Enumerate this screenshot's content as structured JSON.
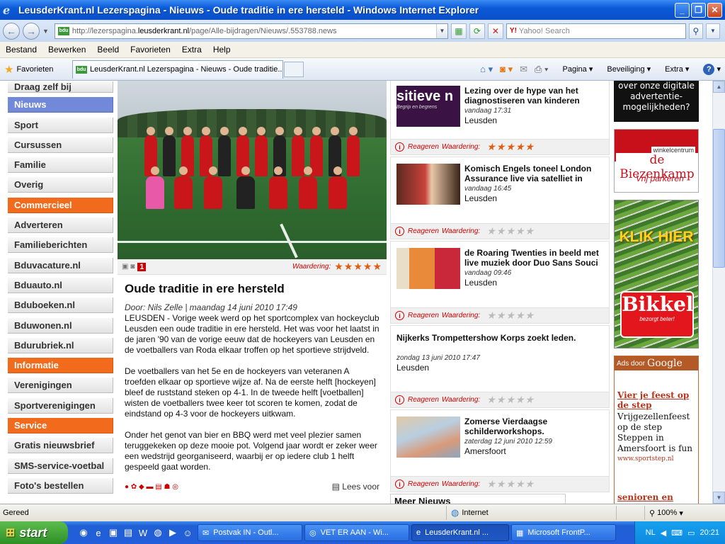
{
  "window": {
    "title": "LeusderKrant.nl Lezerspagina - Nieuws - Oude traditie in ere hersteld - Windows Internet Explorer"
  },
  "browser": {
    "url_prefix": "http://lezerspagina.",
    "url_domain": "leusderkrant.nl",
    "url_path": "/page/Alle-bijdragen/Nieuws/.553788.news",
    "search_placeholder": "Yahoo! Search",
    "menu": [
      "Bestand",
      "Bewerken",
      "Beeld",
      "Favorieten",
      "Extra",
      "Help"
    ],
    "favorites_label": "Favorieten",
    "tab_title": "LeusderKrant.nl Lezerspagina - Nieuws - Oude traditie...",
    "commands": {
      "page": "Pagina",
      "security": "Beveiliging",
      "extra": "Extra"
    }
  },
  "sidebar": {
    "items": [
      {
        "label": "Draag zelf bij",
        "type": "normal"
      },
      {
        "label": "Nieuws",
        "type": "active"
      },
      {
        "label": "Sport",
        "type": "normal"
      },
      {
        "label": "Cursussen",
        "type": "normal"
      },
      {
        "label": "Familie",
        "type": "normal"
      },
      {
        "label": "Overig",
        "type": "normal"
      },
      {
        "label": "Commercieel",
        "type": "section"
      },
      {
        "label": "Adverteren",
        "type": "normal"
      },
      {
        "label": "Familieberichten",
        "type": "normal"
      },
      {
        "label": "Bduvacature.nl",
        "type": "normal"
      },
      {
        "label": "Bduauto.nl",
        "type": "normal"
      },
      {
        "label": "Bduboeken.nl",
        "type": "normal"
      },
      {
        "label": "Bduwonen.nl",
        "type": "normal"
      },
      {
        "label": "Bdurubriek.nl",
        "type": "normal"
      },
      {
        "label": "Informatie",
        "type": "section"
      },
      {
        "label": "Verenigingen",
        "type": "normal"
      },
      {
        "label": "Sportverenigingen",
        "type": "normal"
      },
      {
        "label": "Service",
        "type": "section"
      },
      {
        "label": "Gratis nieuwsbrief",
        "type": "normal"
      },
      {
        "label": "SMS-service-voetbal",
        "type": "normal"
      },
      {
        "label": "Foto's bestellen",
        "type": "normal"
      }
    ]
  },
  "article": {
    "photo_count": "1",
    "rating_label": "Waardering:",
    "title": "Oude traditie in ere hersteld",
    "byline": "Door: Nils Zelle | maandag 14 juni 2010 17:49",
    "paragraphs": [
      "LEUSDEN - Vorige week werd op het sportcomplex van hockeyclub Leusden een oude traditie in ere hersteld. Het was voor het laatst in de jaren '90 van de vorige eeuw dat de hockeyers van Leusden en de voetballers van Roda elkaar troffen op het sportieve strijdveld.",
      "De voetballers van het 5e en de hockeyers van veteranen A troefden elkaar op sportieve wijze af. Na de eerste helft [hockeyen] bleef de ruststand steken op 4-1. In de tweede helft [voetballen] wisten de voetballers twee keer tot scoren te komen, zodat de eindstand op 4-3 voor de hockeyers uitkwam.",
      "Onder het genot van bier en BBQ werd met veel plezier samen teruggekeken op deze mooie pot. Volgend jaar wordt er zeker weer een wedstrijd georganiseerd, waarbij er op iedere club 1 helft gespeeld gaat worden."
    ],
    "read_more": "Lees voor"
  },
  "news": {
    "footer_react": "Reageren",
    "footer_rating": "Waardering:",
    "items": [
      {
        "title": "Lezing over de hype van het diagnostiseren van kinderen",
        "time": "vandaag 17:31",
        "location": "Leusden",
        "rated": true,
        "thumb_text": "sitieve n",
        "thumb_sub": "Begrip en begrens"
      },
      {
        "title": "Komisch Engels toneel London Assurance live via satelliet in",
        "time": "vandaag 16:45",
        "location": "Leusden",
        "rated": false
      },
      {
        "title": "de Roaring Twenties in beeld met live muziek door Duo Sans Souci",
        "time": "vandaag 09:46",
        "location": "Leusden",
        "rated": false
      },
      {
        "title": "Nijkerks Trompettershow Korps zoekt leden.",
        "time": "zondag 13 juni 2010 17:47",
        "location": "Leusden",
        "rated": false
      },
      {
        "title": "Zomerse Vierdaagse schilderworkshops.",
        "time": "zaterdag 12 juni 2010 12:59",
        "location": "Amersfoort",
        "rated": false
      }
    ],
    "more_header": "Meer Nieuws"
  },
  "ads": {
    "ad1_text": "over onze digitale advertentie-mogelijkheden?",
    "ad2_small": "winkelcentrum",
    "ad2_big": "de Biezenkamp",
    "ad2_script": "Vrij parkeren",
    "ad3_klik": "KLIK HIER",
    "ad3_brand": "Bikkel",
    "ad3_slogan": "bezorgt beter!",
    "google_label": "Ads door",
    "google_brand": "Google",
    "google_link": "Vier je feest op de step",
    "google_desc": "Vrijgezellenfeest op de step Steppen in Amersfoort is fun",
    "google_site": "www.sportstep.nl",
    "google_link2": "senioren en wonen"
  },
  "status": {
    "text": "Gereed",
    "zone": "Internet",
    "zoom": "100%"
  },
  "taskbar": {
    "start": "start",
    "tasks": [
      {
        "label": "Postvak IN - Outl...",
        "active": false
      },
      {
        "label": "VET ER AAN - Wi...",
        "active": false
      },
      {
        "label": "LeusderKrant.nl ...",
        "active": true
      },
      {
        "label": "Microsoft FrontP...",
        "active": false
      }
    ],
    "lang": "NL",
    "clock": "20:21"
  },
  "colors": {
    "nav_active": "#7288d8",
    "nav_section": "#f26a1b",
    "rating_star": "#e25b10",
    "accent_red": "#cc0000"
  }
}
